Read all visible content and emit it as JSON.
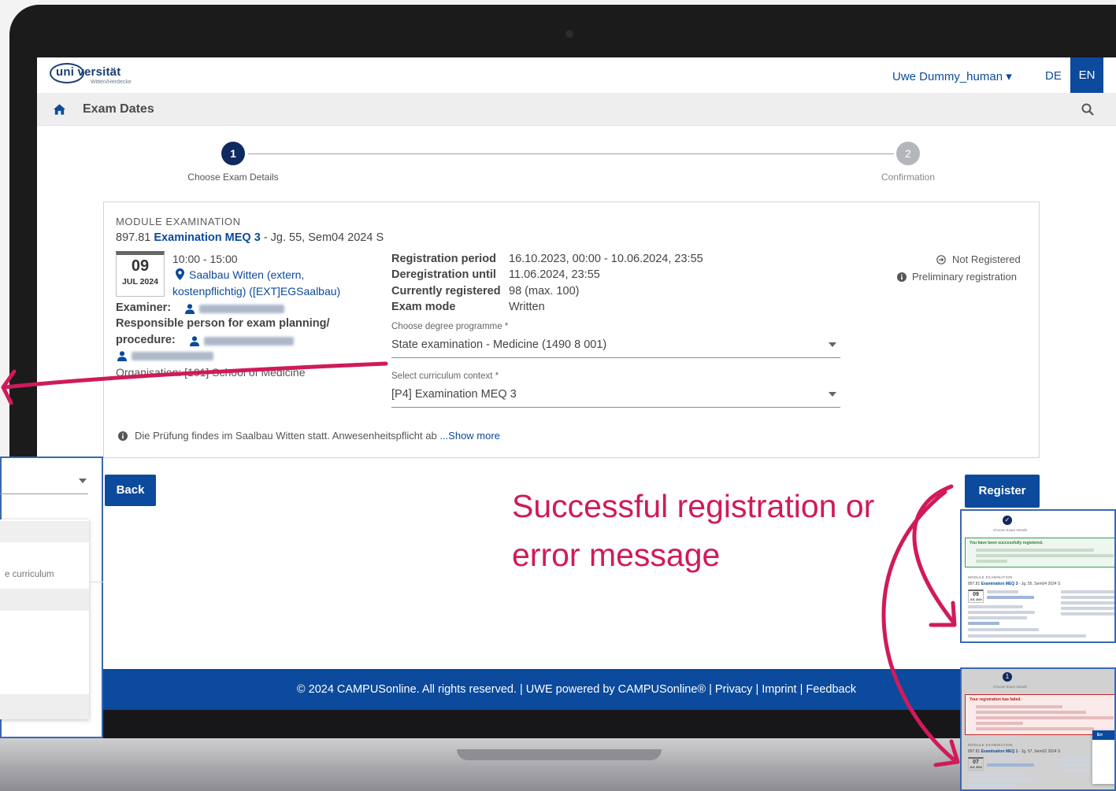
{
  "app": {
    "logo_text": "uni versität",
    "logo_sub": "Witten/Herdecke",
    "user_menu": "Uwe Dummy_human ▾",
    "lang_de": "DE",
    "lang_en": "EN"
  },
  "nav": {
    "title": "Exam Dates"
  },
  "stepper": {
    "step1_num": "1",
    "step1_label": "Choose Exam Details",
    "step2_num": "2",
    "step2_label": "Confirmation"
  },
  "exam": {
    "kind": "MODULE EXAMINATION",
    "number": "897.81",
    "title": "Examination MEQ 3",
    "suffix": " - Jg. 55, Sem04 2024 S",
    "day": "09",
    "month": "JUL 2024",
    "time": "10:00 - 15:00",
    "location_line1": "Saalbau Witten (extern,",
    "location_line2": "kostenpflichtig) ([EXT]EGSaalbau)",
    "examiner_label": "Examiner:",
    "responsible_label_1": "Responsible person for exam planning/",
    "responsible_label_2": "procedure:",
    "organisation_label": "Organisation:  [101] School of Medicine",
    "reg_period_label": "Registration period",
    "reg_period_value": "16.10.2023, 00:00 - 10.06.2024, 23:55",
    "dereg_label": "Deregistration until",
    "dereg_value": "11.06.2024, 23:55",
    "currently_label": "Currently registered",
    "currently_value": "98 (max. 100)",
    "mode_label": "Exam mode",
    "mode_value": "Written",
    "degree_label": "Choose degree programme *",
    "degree_value": "State examination - Medicine (1490 8 001)",
    "curriculum_label": "Select curriculum context *",
    "curriculum_value": "[P4]  Examination MEQ 3",
    "status_registered": "Not Registered",
    "status_preliminary": "Preliminary registration",
    "note_text": "Die Prüfung findes im Saalbau Witten statt.  Anwesenheitspflicht ab ",
    "note_more": "...Show more"
  },
  "buttons": {
    "back": "Back",
    "register": "Register"
  },
  "footer": {
    "text": "© 2024 CAMPUSonline. All rights reserved. | UWE powered by CAMPUSonline® | Privacy | Imprint | Feedback"
  },
  "overlay": {
    "left_panel_text": "e curriculum",
    "annotation_line1": "Successful registration or",
    "annotation_line2": "error message"
  },
  "thumb_success": {
    "step_label": "Choose Exam Details",
    "message": "You have been successfully registered.",
    "kind": "MODULE EXAMINATION",
    "title_num": "897.81",
    "title": "Examination MEQ 3",
    "title_suffix": " - Jg. 55, Sem04 2024 S",
    "day": "09",
    "month": "JUL 2024"
  },
  "thumb_error": {
    "step_label": "Choose Exam Details",
    "message": "Your registration has failed.",
    "kind": "MODULE EXAMINATION",
    "title_num": "897.81",
    "title": "Examination MEQ 1",
    "title_suffix": " - Jg. 57, Sem02 2024 S",
    "day": "07",
    "month": "JUL 2024",
    "dialog_label": "Err"
  },
  "colors": {
    "brand_blue": "#0b4a9c",
    "step_active": "#0f2a5e",
    "annotation": "#d01a5b"
  }
}
